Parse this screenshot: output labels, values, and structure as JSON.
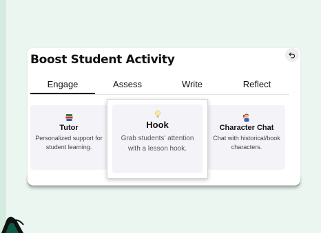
{
  "panel": {
    "title": "Boost Student Activity"
  },
  "icons": {
    "undo": "undo-icon",
    "tutor": "books-icon",
    "hook": "lightbulb-icon",
    "character_chat": "character-icon"
  },
  "tabs": [
    {
      "label": "Engage",
      "active": true
    },
    {
      "label": "Assess",
      "active": false
    },
    {
      "label": "Write",
      "active": false
    },
    {
      "label": "Reflect",
      "active": false
    }
  ],
  "tools": [
    {
      "title": "Tutor",
      "description_line1": "Personalized support for",
      "description_line2": "student learning."
    },
    {
      "title": "Hook",
      "description_line1": "Grab students' attention",
      "description_line2": "with a lesson hook."
    },
    {
      "title": "Character Chat",
      "description_line1": "Chat with historical/book",
      "description_line2": "characters."
    }
  ],
  "colors": {
    "page_background": "#eaf6ef",
    "tile_background": "#f4f3f8",
    "active_tab_underline": "#111111"
  }
}
